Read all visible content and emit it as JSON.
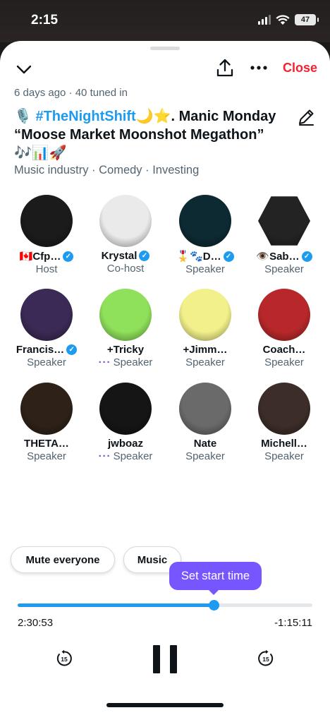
{
  "status": {
    "time": "2:15",
    "battery": "47"
  },
  "header": {
    "close_label": "Close"
  },
  "space": {
    "meta": "6 days ago · 40 tuned in",
    "title_icon": "🎙️",
    "hashtag": "#TheNightShift",
    "title_after_hashtag": "🌙⭐. Manic Monday “Moose Market Moonshot Megathon” 🎶📊🚀",
    "topics": "Music industry · Comedy · Investing"
  },
  "participants": [
    {
      "name": "🇨🇦Cfp…",
      "role": "Host",
      "verified": true,
      "dots": false,
      "color": "#1b1b1b"
    },
    {
      "name": "Krystal",
      "role": "Co-host",
      "verified": true,
      "dots": false,
      "color": "#eaeaea"
    },
    {
      "name": "🎖️🐾D…",
      "role": "Speaker",
      "verified": true,
      "dots": false,
      "color": "#0d2a33"
    },
    {
      "name": "👁️Sab…",
      "role": "Speaker",
      "verified": true,
      "dots": false,
      "color": "#232323"
    },
    {
      "name": "Francis…",
      "role": "Speaker",
      "verified": true,
      "dots": false,
      "color": "#3b2a55"
    },
    {
      "name": "+Tricky",
      "role": "Speaker",
      "verified": false,
      "dots": true,
      "color": "#8fe05a"
    },
    {
      "name": "+Jimm…",
      "role": "Speaker",
      "verified": false,
      "dots": false,
      "color": "#f2f08a"
    },
    {
      "name": "Coach…",
      "role": "Speaker",
      "verified": false,
      "dots": false,
      "color": "#b8282a"
    },
    {
      "name": "THETA…",
      "role": "Speaker",
      "verified": false,
      "dots": false,
      "color": "#2e2218"
    },
    {
      "name": "jwboaz",
      "role": "Speaker",
      "verified": false,
      "dots": true,
      "color": "#151515"
    },
    {
      "name": "Nate",
      "role": "Speaker",
      "verified": false,
      "dots": false,
      "color": "#6a6a6a"
    },
    {
      "name": "Michell…",
      "role": "Speaker",
      "verified": false,
      "dots": false,
      "color": "#3c2d28"
    }
  ],
  "controls": {
    "mute_label": "Mute everyone",
    "music_label": "Music",
    "tooltip": "Set start time",
    "elapsed": "2:30:53",
    "remaining": "-1:15:11",
    "progress": 0.665,
    "skip_seconds": "15"
  },
  "colors": {
    "accent": "#1d9bf0",
    "close": "#f4212e",
    "tooltip": "#7856ff"
  },
  "icons": [
    "chevron-down-icon",
    "share-icon",
    "more-icon",
    "edit-icon",
    "rewind-15-icon",
    "pause-icon",
    "forward-15-icon"
  ]
}
